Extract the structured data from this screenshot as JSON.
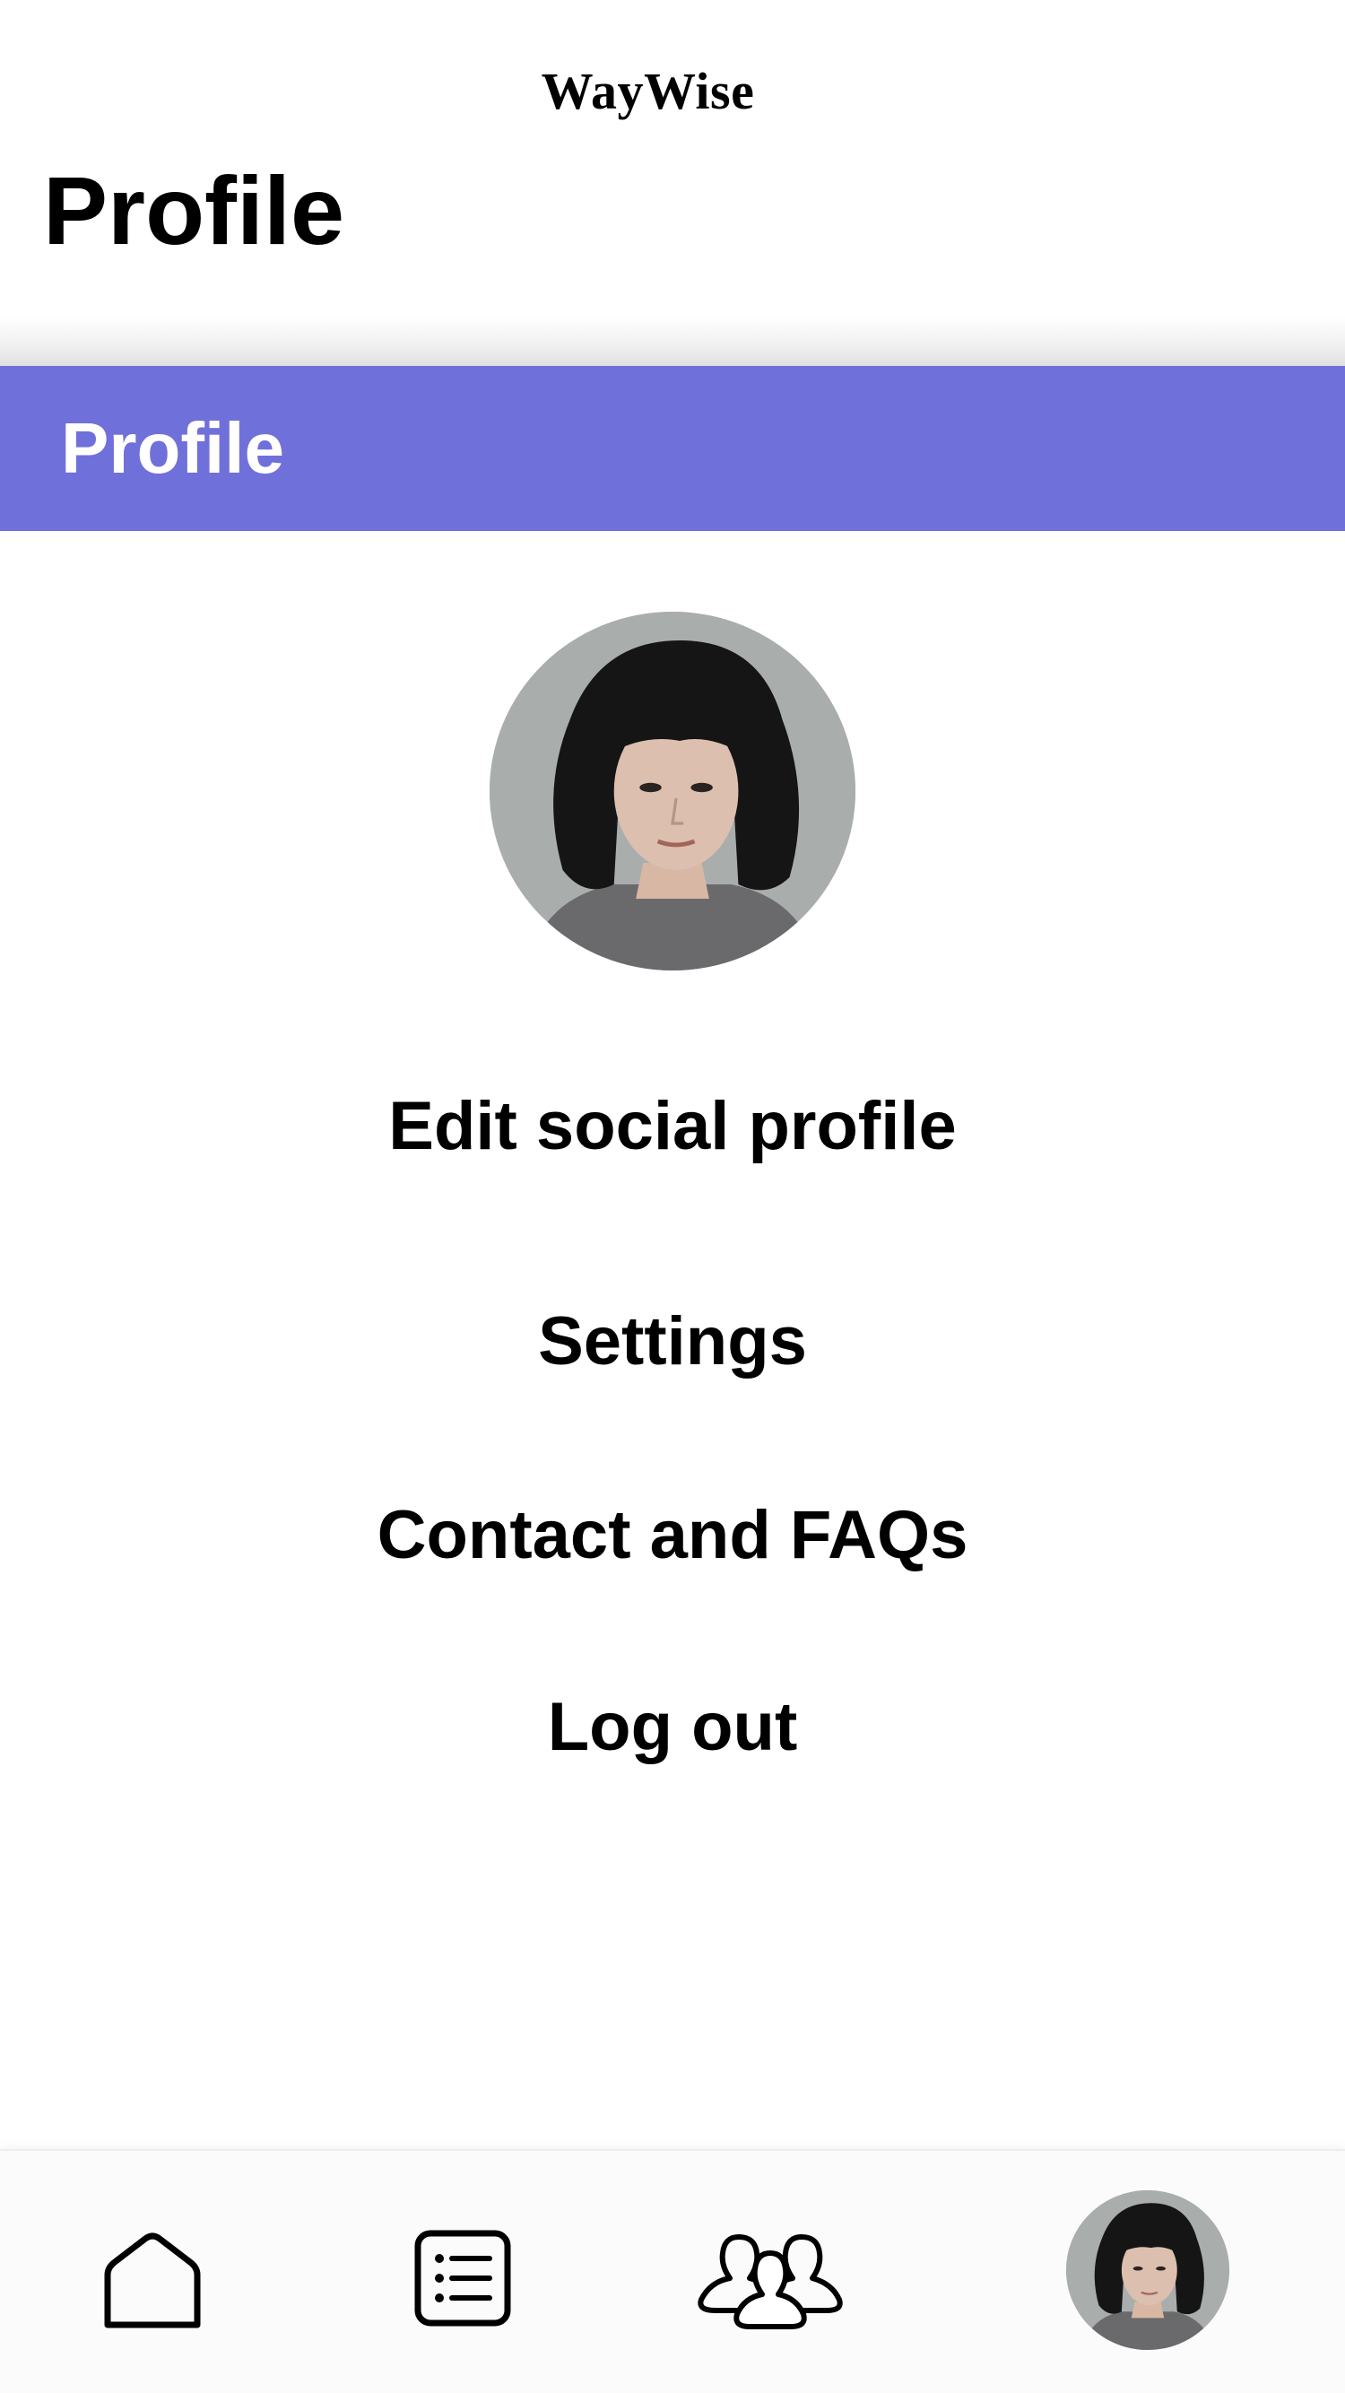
{
  "header": {
    "app_name": "WayWise",
    "page_title": "Profile"
  },
  "section": {
    "title": "Profile"
  },
  "menu": {
    "items": [
      {
        "label": "Edit social profile"
      },
      {
        "label": "Settings"
      },
      {
        "label": "Contact and FAQs"
      },
      {
        "label": "Log out"
      }
    ]
  },
  "bottom_nav": {
    "tabs": [
      {
        "icon": "home-icon"
      },
      {
        "icon": "list-icon"
      },
      {
        "icon": "community-icon"
      },
      {
        "icon": "avatar"
      }
    ]
  },
  "colors": {
    "accent": "#7070da",
    "background": "#ffffff",
    "text": "#000000"
  }
}
